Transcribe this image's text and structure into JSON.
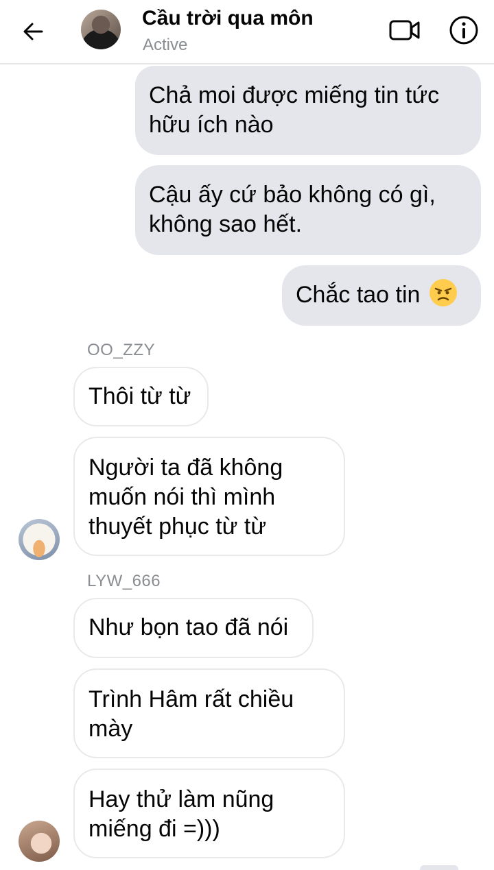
{
  "header": {
    "title": "Cầu trời qua môn",
    "status": "Active"
  },
  "colors": {
    "outgoing_bubble": "#e4e6eb",
    "incoming_border": "#e8e9eb",
    "muted_text": "#8a8d91",
    "emoji_face": "#ffcc4d"
  },
  "icons": [
    "back-arrow-icon",
    "video-call-icon",
    "info-icon",
    "angry-face-emoji"
  ],
  "messages": {
    "out1": {
      "line1": "Chả moi được miếng tin tức",
      "line2": "hữu ích nào"
    },
    "out2": {
      "line1": "Cậu ấy cứ bảo không có gì,",
      "line2": "không sao hết."
    },
    "out3": {
      "text": "Chắc tao tin"
    },
    "sender1": "OO_ZZY",
    "in1": {
      "text": "Thôi từ từ"
    },
    "in2": {
      "line1": "Người ta đã không",
      "line2": "muốn nói thì mình",
      "line3": "thuyết phục từ từ"
    },
    "sender2": "LYW_666",
    "in3": {
      "text": "Như bọn tao đã nói"
    },
    "in4": {
      "line1": "Trình Hâm rất chiều",
      "line2": "mày"
    },
    "in5": {
      "line1": "Hay thử làm nũng",
      "line2": "miếng đi =)))"
    }
  }
}
